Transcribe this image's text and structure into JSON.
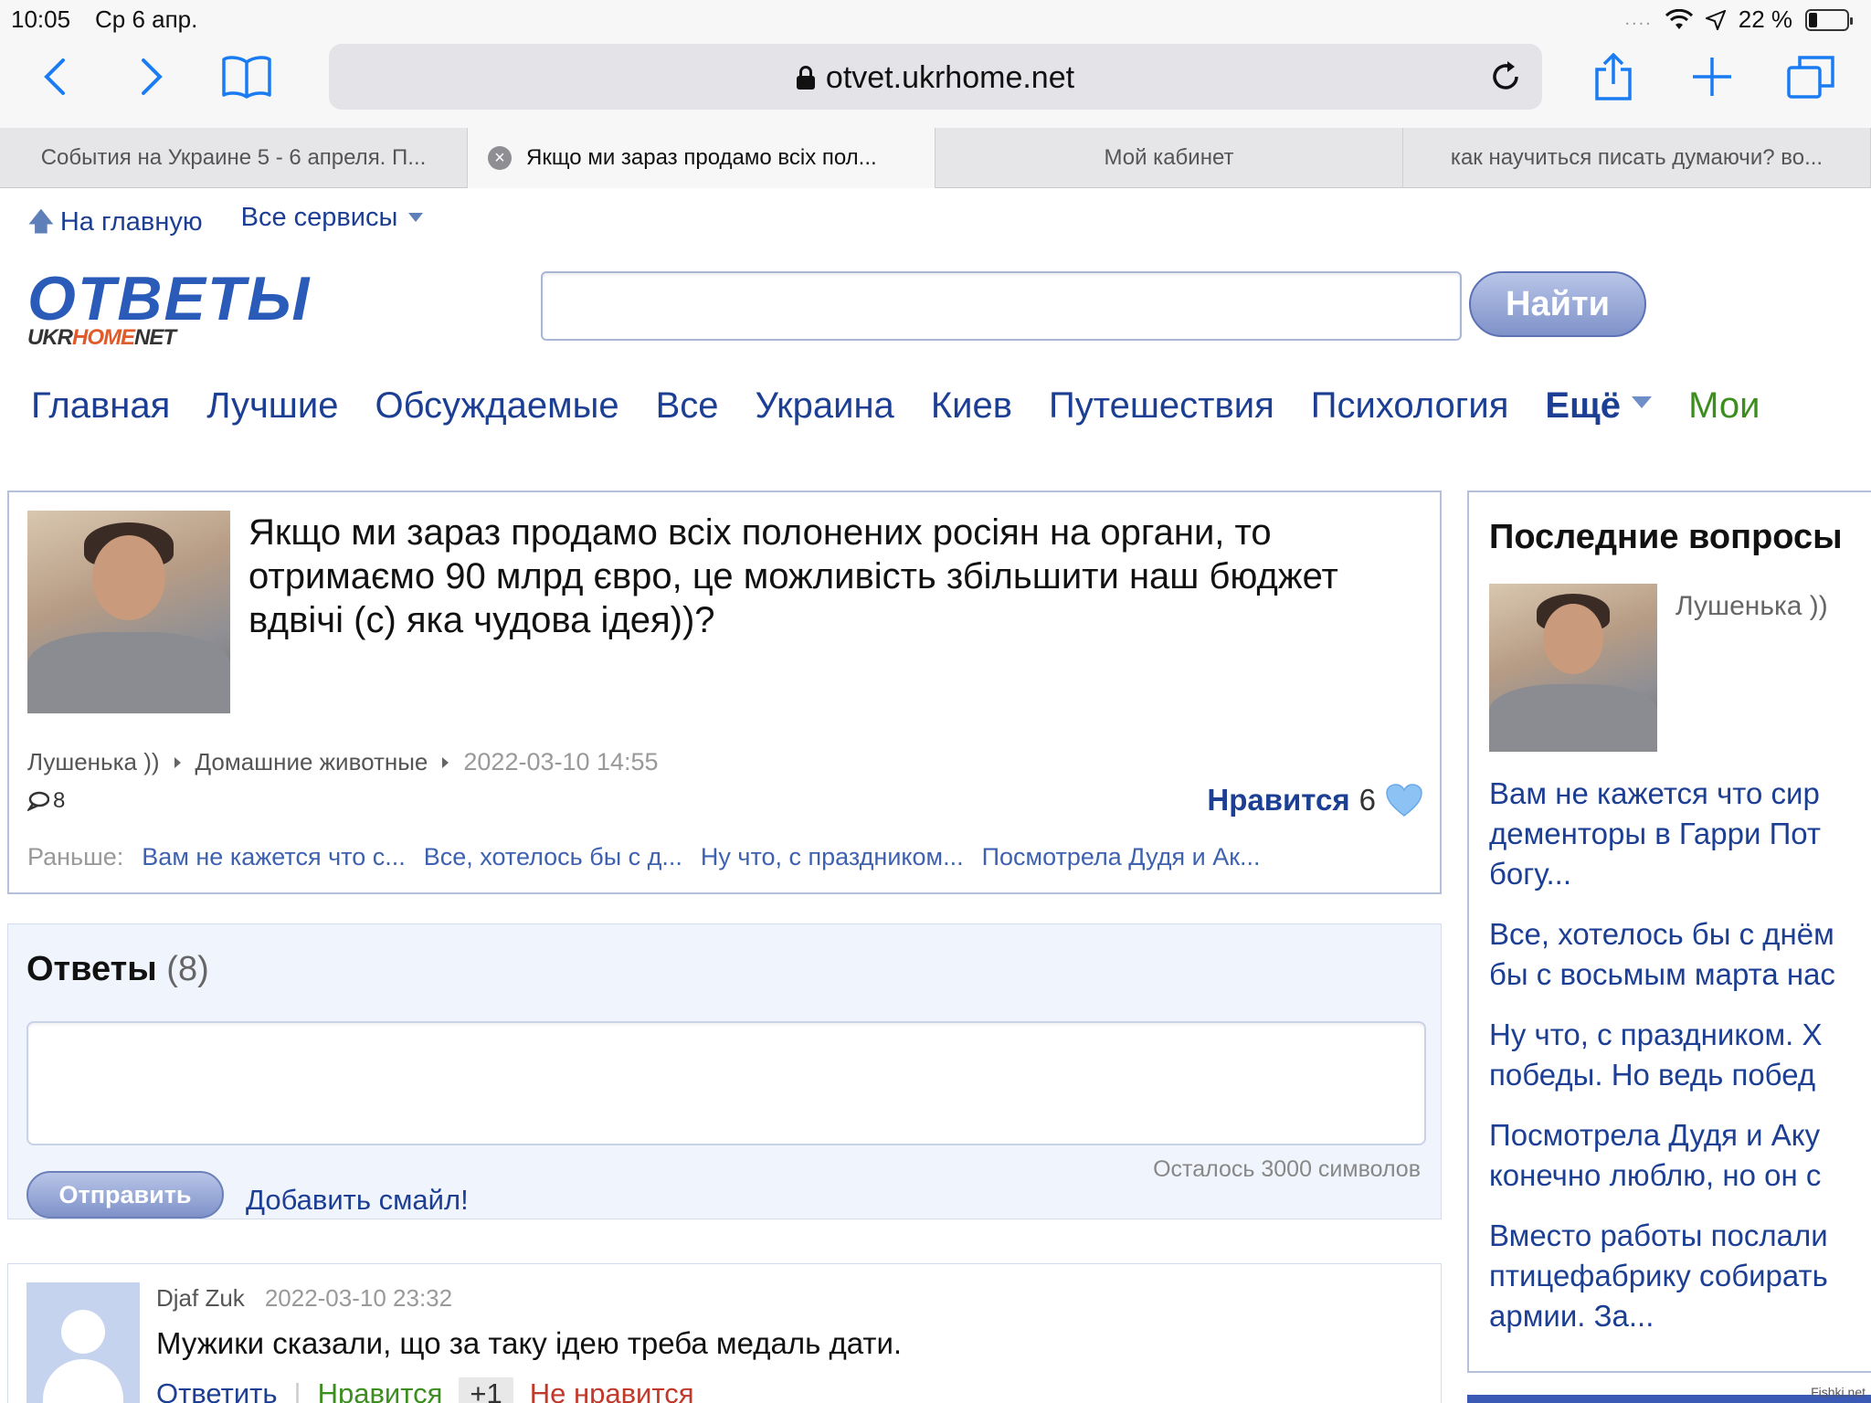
{
  "status_bar": {
    "time": "10:05",
    "date": "Ср 6 апр.",
    "battery": "22 %"
  },
  "browser": {
    "url": "otvet.ukrhome.net"
  },
  "tabs": [
    {
      "title": "События на Украине 5 - 6 апреля. П..."
    },
    {
      "title": "Якщо ми зараз продамо всіх пол..."
    },
    {
      "title": "Мой кабинет"
    },
    {
      "title": "как научиться писать думаючи? во..."
    }
  ],
  "topnav": {
    "home": "На главную",
    "services": "Все сервисы"
  },
  "logo": {
    "big": "ОТВЕТЫ",
    "small_a": "UKR",
    "small_b": "HOME",
    "small_c": "NET"
  },
  "search": {
    "button": "Найти"
  },
  "mainnav": {
    "items": [
      "Главная",
      "Лучшие",
      "Обсуждаемые",
      "Все",
      "Украина",
      "Киев",
      "Путешествия",
      "Психология"
    ],
    "more": "Ещё",
    "mine": "Мои"
  },
  "question": {
    "title": "Якщо ми зараз продамо всіх полонених росіян на органи, то отримаємо 90 млрд євро, це можливість збільшити наш бюджет вдвічі (с) яка чудова ідея))?",
    "author": "Лушенька ))",
    "category": "Домашние животные",
    "date": "2022-03-10 14:55",
    "comments": "8",
    "like_label": "Нравится",
    "like_count": "6",
    "prev_label": "Раньше:",
    "prev_links": [
      "Вам не кажется что с...",
      "Все, хотелось бы с д...",
      "Ну что, с праздником...",
      "Посмотрела Дудя и Ак..."
    ]
  },
  "answers_form": {
    "title": "Ответы",
    "count": "(8)",
    "remaining": "Осталось 3000 символов",
    "send": "Отправить",
    "smile": "Добавить смайл!"
  },
  "first_answer": {
    "author": "Djaf Zuk",
    "date": "2022-03-10 23:32",
    "text": "Мужики сказали, що за таку ідею треба медаль дати.",
    "reply": "Ответить",
    "like": "Нравится",
    "like_count": "+1",
    "dislike": "Не нравится"
  },
  "sidebar": {
    "title": "Последние вопросы",
    "author": "Лушенька ))",
    "questions": [
      "Вам не кажется что сир\nдементоры в Гарри Пот\nбогу...",
      "Все, хотелось бы с днём\nбы с восьмым марта нас",
      "Ну что, с праздником. Х\nпобеды. Но ведь побед",
      "Посмотрела Дудя и Аку\nконечно люблю, но он с",
      "Вместо работы послали\nптицефабрику собирать\nармии. За..."
    ]
  },
  "watermark": "Fishki.net"
}
